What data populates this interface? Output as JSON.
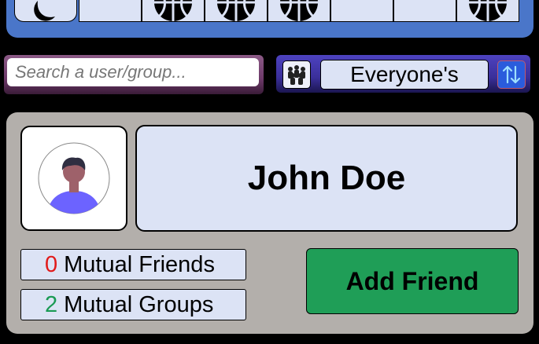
{
  "nav": {
    "tabs": [
      {
        "icon": "moon-icon"
      },
      {
        "icon": ""
      },
      {
        "icon": "basketball-icon"
      },
      {
        "icon": "basketball-icon"
      },
      {
        "icon": "basketball-icon"
      },
      {
        "icon": ""
      },
      {
        "icon": ""
      },
      {
        "icon": "basketball-icon"
      }
    ],
    "accent_color": "#4a76c9"
  },
  "search": {
    "placeholder": "Search a user/group...",
    "value": ""
  },
  "filter": {
    "group_icon": "group-people-icon",
    "scope_label": "Everyone's",
    "sort_icon": "sort-arrows-icon"
  },
  "profile": {
    "avatar_icon": "user-avatar-icon",
    "name": "John Doe",
    "mutual_friends_count": "0",
    "mutual_friends_label": "Mutual Friends",
    "mutual_groups_count": "2",
    "mutual_groups_label": "Mutual Groups",
    "add_button_label": "Add Friend",
    "add_button_color": "#1f9e57"
  }
}
